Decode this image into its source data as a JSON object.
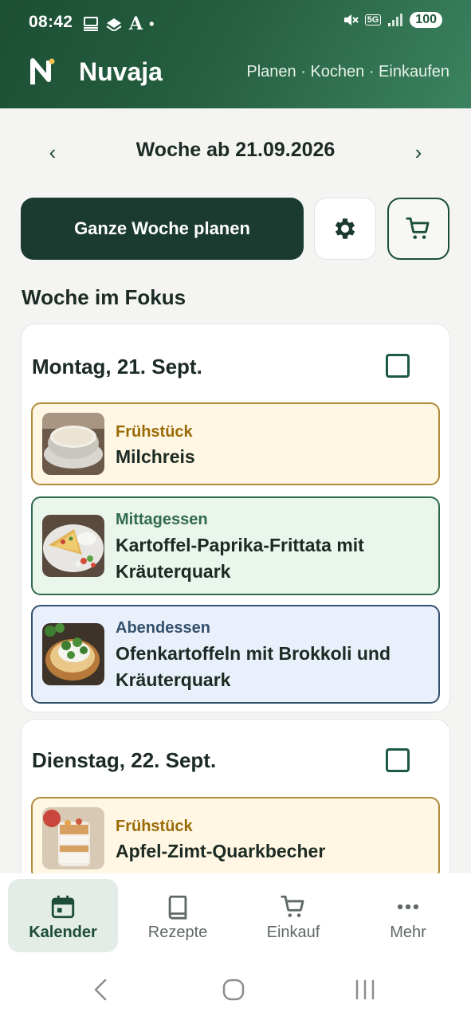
{
  "status_bar": {
    "time": "08:42",
    "left_icons": [
      "notification-icon",
      "layers-icon",
      "font-icon",
      "dot"
    ],
    "network": "5G",
    "battery": "100"
  },
  "app": {
    "name": "Nuvaja",
    "nav_text": "Planen · Kochen · Einkaufen",
    "brand_color": "#1c4f34",
    "logo_accent": "#f2c14e"
  },
  "week": {
    "title": "Woche ab 21.09.2026",
    "prev": "‹",
    "next": "›"
  },
  "actions": {
    "plan_week_label": "Ganze Woche planen",
    "settings_icon": "gear-icon",
    "cart_icon": "cart-icon"
  },
  "section": {
    "title": "Woche im Fokus"
  },
  "days": [
    {
      "title": "Montag, 21. Sept.",
      "checked": false,
      "meals": [
        {
          "type": "Frühstück",
          "name": "Milchreis",
          "image": "rice-pudding-bowl"
        },
        {
          "type": "Mittagessen",
          "name": "Kartoffel-Paprika-Frittata mit Kräuterquark",
          "image": "frittata-plate"
        },
        {
          "type": "Abendessen",
          "name": "Ofenkartoffeln mit Brokkoli und Kräuterquark",
          "image": "baked-potato-broccoli"
        }
      ]
    },
    {
      "title": "Dienstag, 22. Sept.",
      "checked": false,
      "meals": [
        {
          "type": "Frühstück",
          "name": "Apfel-Zimt-Quarkbecher",
          "image": "apple-quark-cup"
        }
      ]
    }
  ],
  "bottom_nav": [
    {
      "label": "Kalender",
      "icon": "calendar-icon",
      "active": true
    },
    {
      "label": "Rezepte",
      "icon": "book-icon",
      "active": false
    },
    {
      "label": "Einkauf",
      "icon": "cart-icon",
      "active": false
    },
    {
      "label": "Mehr",
      "icon": "more-icon",
      "active": false
    }
  ]
}
